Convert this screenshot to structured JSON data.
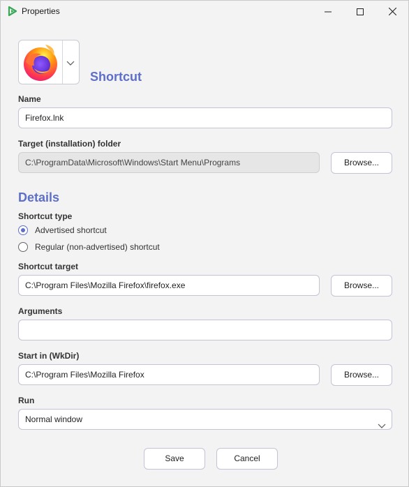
{
  "window": {
    "title": "Properties"
  },
  "section_shortcut": {
    "heading": "Shortcut"
  },
  "name": {
    "label": "Name",
    "value": "Firefox.lnk"
  },
  "target_folder": {
    "label": "Target (installation) folder",
    "value": "C:\\ProgramData\\Microsoft\\Windows\\Start Menu\\Programs",
    "browse_label": "Browse..."
  },
  "details": {
    "heading": "Details"
  },
  "shortcut_type": {
    "label": "Shortcut type",
    "options": [
      {
        "label": "Advertised shortcut",
        "checked": true
      },
      {
        "label": "Regular (non-advertised) shortcut",
        "checked": false
      }
    ]
  },
  "shortcut_target": {
    "label": "Shortcut target",
    "value": "C:\\Program Files\\Mozilla Firefox\\firefox.exe",
    "browse_label": "Browse..."
  },
  "arguments": {
    "label": "Arguments",
    "value": ""
  },
  "start_in": {
    "label": "Start in (WkDir)",
    "value": "C:\\Program Files\\Mozilla Firefox",
    "browse_label": "Browse..."
  },
  "run": {
    "label": "Run",
    "value": "Normal window"
  },
  "footer": {
    "save_label": "Save",
    "cancel_label": "Cancel"
  },
  "colors": {
    "accent": "#5d6fc8",
    "firefox_orange": "#ff7139",
    "firefox_purple": "#7542e5"
  },
  "icons": {
    "app": "app-logo-icon",
    "minimize": "minimize-icon",
    "maximize": "maximize-icon",
    "close": "close-icon",
    "firefox": "firefox-icon",
    "dropdown": "chevron-down-icon"
  }
}
